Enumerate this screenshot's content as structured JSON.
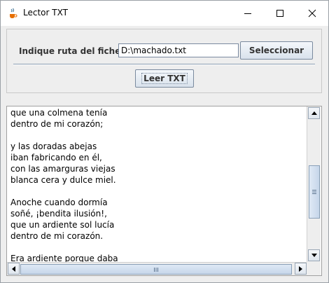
{
  "window": {
    "title": "Lector TXT",
    "icon": "java-cup-icon"
  },
  "form": {
    "path_label": "Indique ruta del fichero:",
    "path_value": "D:\\machado.txt",
    "select_button": "Seleccionar",
    "read_button": "Leer TXT"
  },
  "text_area": {
    "lines": [
      "que una colmena tenía",
      "dentro de mi corazón;",
      "",
      "y las doradas abejas",
      "iban fabricando en él,",
      "con las amarguras viejas",
      "blanca cera y dulce miel.",
      "",
      "Anoche cuando dormía",
      "soñé, ¡bendita ilusión!,",
      "que un ardiente sol lucía",
      "dentro de mi corazón.",
      "",
      "Era ardiente porque daba"
    ]
  },
  "colors": {
    "accent": "#8b9db3",
    "button_gradient_top": "#f4f7fb",
    "button_gradient_bottom": "#d9e2ec"
  }
}
